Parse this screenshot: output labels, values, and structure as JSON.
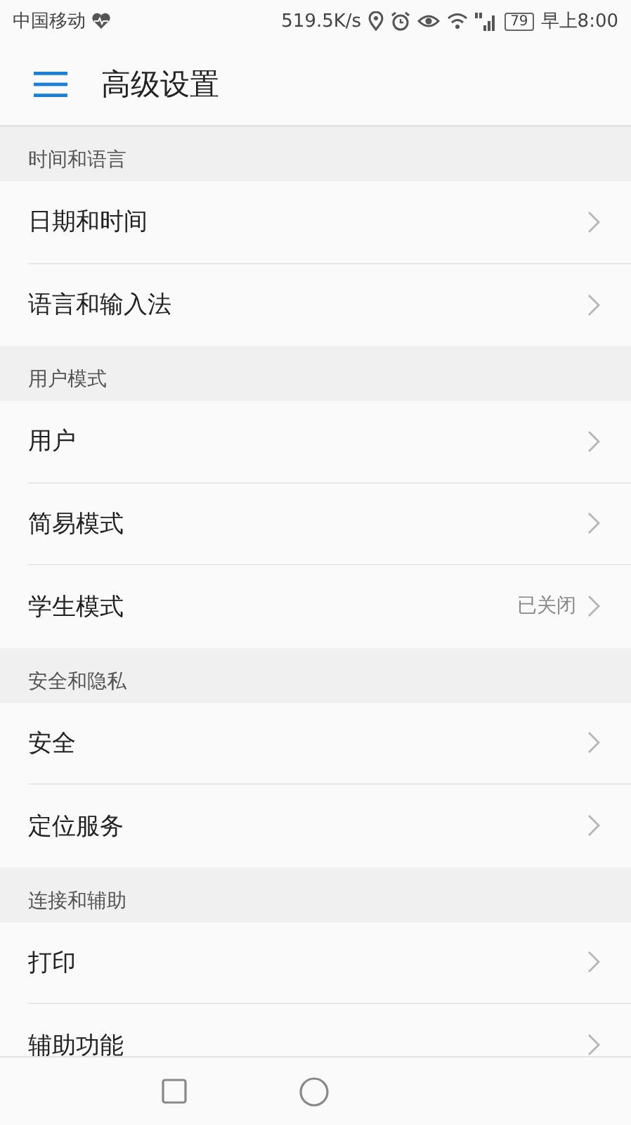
{
  "status_bar": {
    "carrier": "中国移动",
    "speed": "519.5K/s",
    "battery": "79",
    "time": "早上8:00"
  },
  "header": {
    "title": "高级设置"
  },
  "sections": [
    {
      "title": "时间和语言",
      "items": [
        {
          "label": "日期和时间"
        },
        {
          "label": "语言和输入法"
        }
      ]
    },
    {
      "title": "用户模式",
      "items": [
        {
          "label": "用户"
        },
        {
          "label": "简易模式"
        },
        {
          "label": "学生模式",
          "value": "已关闭"
        }
      ]
    },
    {
      "title": "安全和隐私",
      "items": [
        {
          "label": "安全"
        },
        {
          "label": "定位服务"
        }
      ]
    },
    {
      "title": "连接和辅助",
      "items": [
        {
          "label": "打印"
        },
        {
          "label": "辅助功能"
        }
      ]
    }
  ]
}
